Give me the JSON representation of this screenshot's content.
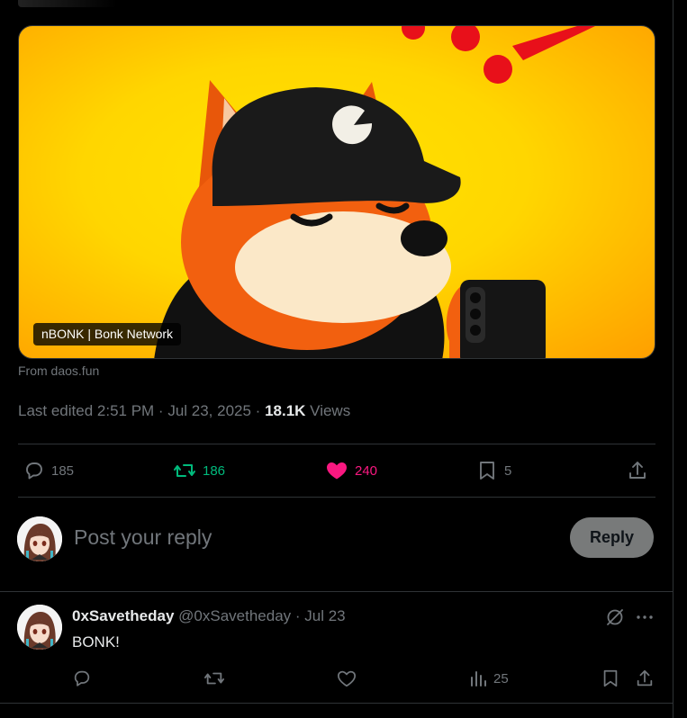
{
  "card": {
    "label": "nBONK | Bonk Network",
    "source": "From daos.fun"
  },
  "meta": {
    "edited": "Last edited 2:51 PM · Jul 23, 2025 · ",
    "views_count": "18.1K",
    "views_label": " Views"
  },
  "actions": {
    "replies": "185",
    "reposts": "186",
    "likes": "240",
    "bookmarks": "5"
  },
  "composer": {
    "placeholder": "Post your reply",
    "button": "Reply"
  },
  "reply": {
    "name": "0xSavetheday",
    "handle": "@0xSavetheday",
    "separator": " · ",
    "date": "Jul 23",
    "text": "BONK!",
    "views": "25"
  },
  "colors": {
    "background": "#000000",
    "repost_active": "#00ba7c",
    "like_active": "#f91880",
    "muted": "#71767b"
  },
  "icons": [
    "reply-icon",
    "repost-icon",
    "heart-icon",
    "bookmark-icon",
    "share-icon",
    "grok-icon",
    "more-icon",
    "views-icon"
  ]
}
